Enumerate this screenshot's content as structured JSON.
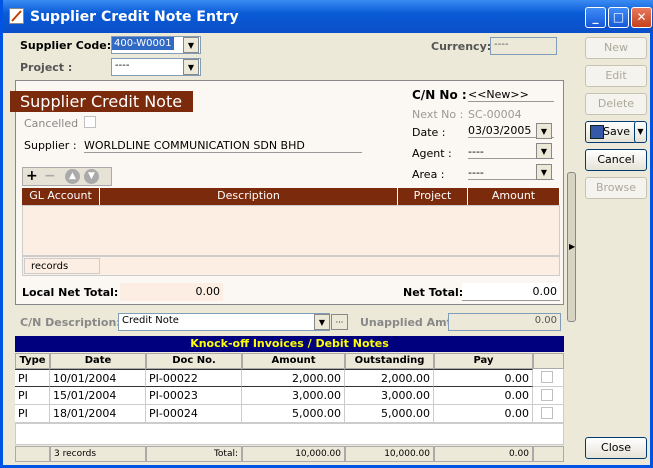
{
  "window": {
    "title": "Supplier Credit Note Entry",
    "min": "_",
    "max": "□",
    "close": "✕"
  },
  "header": {
    "supplier_code_label": "Supplier Code:",
    "supplier_code": "400-W0001",
    "project_label": "Project :",
    "project": "----",
    "currency_label": "Currency:",
    "currency": "----"
  },
  "buttons": {
    "new": "New",
    "edit": "Edit",
    "delete": "Delete",
    "save": "Save",
    "cancel": "Cancel",
    "browse": "Browse",
    "close": "Close"
  },
  "form": {
    "title": "Supplier Credit Note",
    "cancelled_label": "Cancelled",
    "supplier_label": "Supplier :",
    "supplier_name": "WORLDLINE COMMUNICATION SDN BHD",
    "cn_no_label": "C/N No :",
    "cn_no": "<<New>>",
    "next_no_label": "Next No :",
    "next_no": "SC-00004",
    "date_label": "Date :",
    "date": "03/03/2005",
    "agent_label": "Agent :",
    "agent": "----",
    "area_label": "Area :",
    "area": "----"
  },
  "grid": {
    "columns": [
      "GL Account",
      "Description",
      "Project",
      "Amount"
    ],
    "records": "records"
  },
  "totals": {
    "local_label": "Local Net Total:",
    "local_value": "0.00",
    "net_label": "Net Total:",
    "net_value": "0.00"
  },
  "desc": {
    "label": "C/N Description:",
    "value": "Credit Note",
    "unapplied_label": "Unapplied Amt:",
    "unapplied_value": "0.00",
    "more": "···"
  },
  "knockoff": {
    "title": "Knock-off Invoices / Debit Notes",
    "columns": [
      "Type",
      "Date",
      "Doc No.",
      "Amount",
      "Outstanding",
      "Pay"
    ],
    "rows": [
      {
        "type": "PI",
        "date": "10/01/2004",
        "doc": "PI-00022",
        "amount": "2,000.00",
        "outstanding": "2,000.00",
        "pay": "0.00"
      },
      {
        "type": "PI",
        "date": "15/01/2004",
        "doc": "PI-00023",
        "amount": "3,000.00",
        "outstanding": "3,000.00",
        "pay": "0.00"
      },
      {
        "type": "PI",
        "date": "18/01/2004",
        "doc": "PI-00024",
        "amount": "5,000.00",
        "outstanding": "5,000.00",
        "pay": "0.00"
      }
    ],
    "footer": {
      "records": "3 records",
      "total_label": "Total:",
      "amount": "10,000.00",
      "outstanding": "10,000.00",
      "pay": "0.00"
    }
  },
  "colors": {
    "title_bar": "#0a5bd6",
    "header_maroon": "#7b2a0c",
    "knockoff_title": "#00007f"
  }
}
